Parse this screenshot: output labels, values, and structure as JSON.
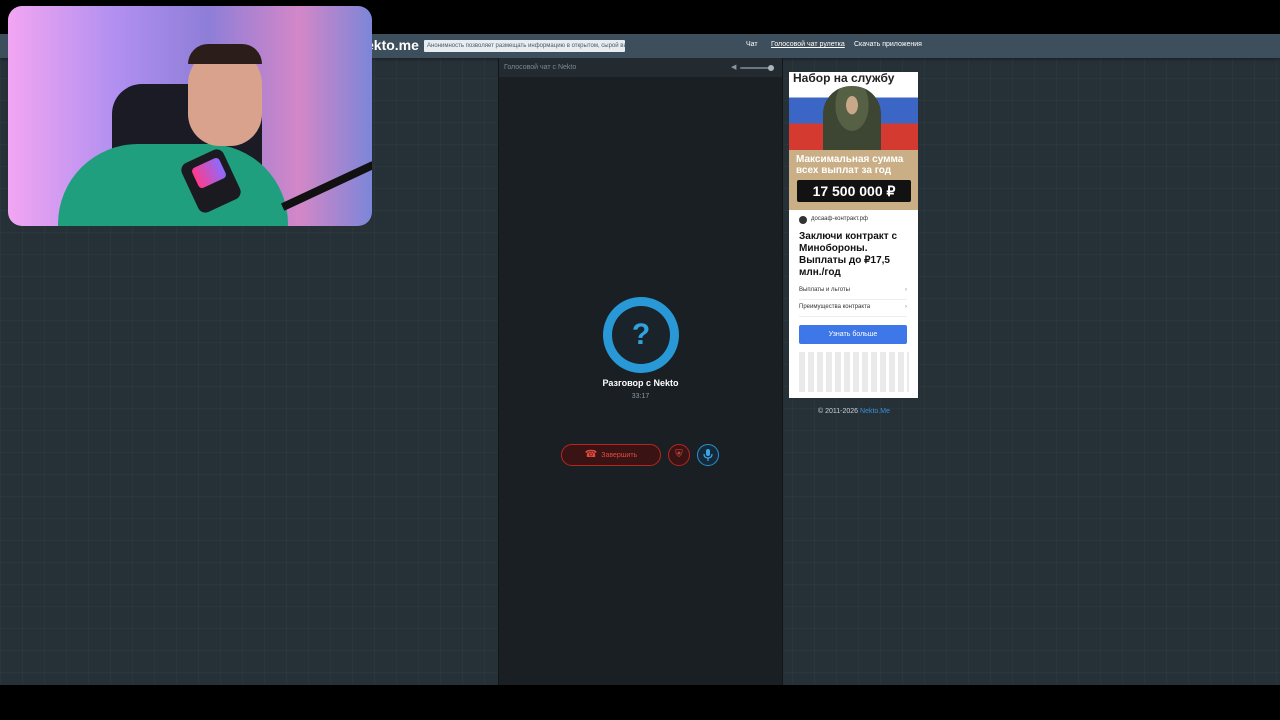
{
  "header": {
    "logo": "ekto.me",
    "notice": "Анонимность позволяет размещать информацию в открытом, сырой вида!",
    "nav": [
      "Чат",
      "Голосовой чат рулетка",
      "Скачать приложения"
    ]
  },
  "chat": {
    "header_title": "Голосовой чат с Nekto",
    "avatar_glyph": "?",
    "conversation_title": "Разговор с Nekto",
    "timer": "33:17",
    "end_button_label": "Завершить",
    "end_button_icon": "phone-hangup-icon",
    "report_icon": "shield-icon",
    "mic_icon": "microphone-icon",
    "volume_icon": "speaker-icon",
    "volume_level": 0.9
  },
  "ad": {
    "headline": "Набор на службу",
    "sum_label": "Максимальная сумма всех выплат за год",
    "amount": "17 500 000 ₽",
    "domain": "досааф-контракт.рф",
    "text": "Заключи контракт с Минобороны. Выплаты до ₽17,5 млн./год",
    "links": [
      "Выплаты и льготы",
      "Преимущества контракта"
    ],
    "cta": "Узнать больше"
  },
  "footer": {
    "copyright": "© 2011-2026",
    "brand": "Nekto.Me"
  },
  "colors": {
    "accent_blue": "#2899d6",
    "danger_red": "#b8261f",
    "background": "#263037",
    "topbar": "#3d4e5c"
  }
}
